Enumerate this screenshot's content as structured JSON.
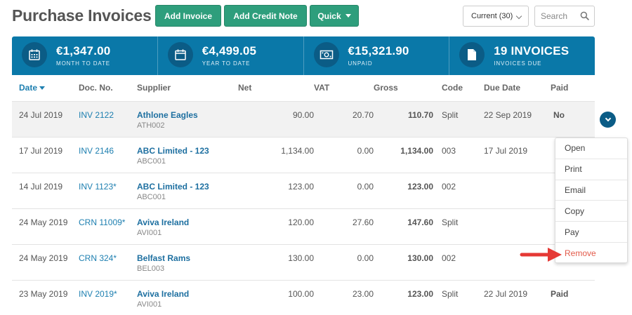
{
  "page": {
    "title": "Purchase Invoices"
  },
  "toolbar": {
    "add_invoice": "Add Invoice",
    "add_credit_note": "Add Credit Note",
    "quick": "Quick",
    "filter_value": "Current (30)",
    "search_placeholder": "Search"
  },
  "stats": [
    {
      "value": "€1,347.00",
      "label": "MONTH TO DATE",
      "icon": "calendar-month-icon"
    },
    {
      "value": "€4,499.05",
      "label": "YEAR TO DATE",
      "icon": "calendar-icon"
    },
    {
      "value": "€15,321.90",
      "label": "UNPAID",
      "icon": "banknote-icon"
    },
    {
      "value": "19 INVOICES",
      "label": "INVOICES DUE",
      "icon": "document-icon"
    }
  ],
  "table": {
    "headers": {
      "date": "Date",
      "doc_no": "Doc. No.",
      "supplier": "Supplier",
      "net": "Net",
      "vat": "VAT",
      "gross": "Gross",
      "code": "Code",
      "due_date": "Due Date",
      "paid": "Paid"
    },
    "rows": [
      {
        "date": "24 Jul 2019",
        "doc_no": "INV 2122",
        "supplier": "Athlone Eagles",
        "supplier_code": "ATH002",
        "net": "90.00",
        "vat": "20.70",
        "gross": "110.70",
        "code": "Split",
        "due_date": "22 Sep 2019",
        "paid": "No"
      },
      {
        "date": "17 Jul 2019",
        "doc_no": "INV 2146",
        "supplier": "ABC Limited - 123",
        "supplier_code": "ABC001",
        "net": "1,134.00",
        "vat": "0.00",
        "gross": "1,134.00",
        "code": "003",
        "due_date": "17 Jul 2019",
        "paid": ""
      },
      {
        "date": "14 Jul 2019",
        "doc_no": "INV 1123*",
        "supplier": "ABC Limited - 123",
        "supplier_code": "ABC001",
        "net": "123.00",
        "vat": "0.00",
        "gross": "123.00",
        "code": "002",
        "due_date": "",
        "paid": ""
      },
      {
        "date": "24 May 2019",
        "doc_no": "CRN 11009*",
        "supplier": "Aviva Ireland",
        "supplier_code": "AVI001",
        "net": "120.00",
        "vat": "27.60",
        "gross": "147.60",
        "code": "Split",
        "due_date": "",
        "paid": ""
      },
      {
        "date": "24 May 2019",
        "doc_no": "CRN 324*",
        "supplier": "Belfast Rams",
        "supplier_code": "BEL003",
        "net": "130.00",
        "vat": "0.00",
        "gross": "130.00",
        "code": "002",
        "due_date": "",
        "paid": ""
      },
      {
        "date": "23 May 2019",
        "doc_no": "INV 2019*",
        "supplier": "Aviva Ireland",
        "supplier_code": "AVI001",
        "net": "100.00",
        "vat": "23.00",
        "gross": "123.00",
        "code": "Split",
        "due_date": "22 Jul 2019",
        "paid": "Paid"
      }
    ]
  },
  "context_menu": {
    "items": [
      "Open",
      "Print",
      "Email",
      "Copy",
      "Pay",
      "Remove"
    ]
  },
  "colors": {
    "accent_green": "#2e9e7c",
    "stats_blue": "#0a78a8",
    "link_blue": "#1d7fb0",
    "unpaid_red": "#e02020",
    "arrow_red": "#e53935"
  }
}
